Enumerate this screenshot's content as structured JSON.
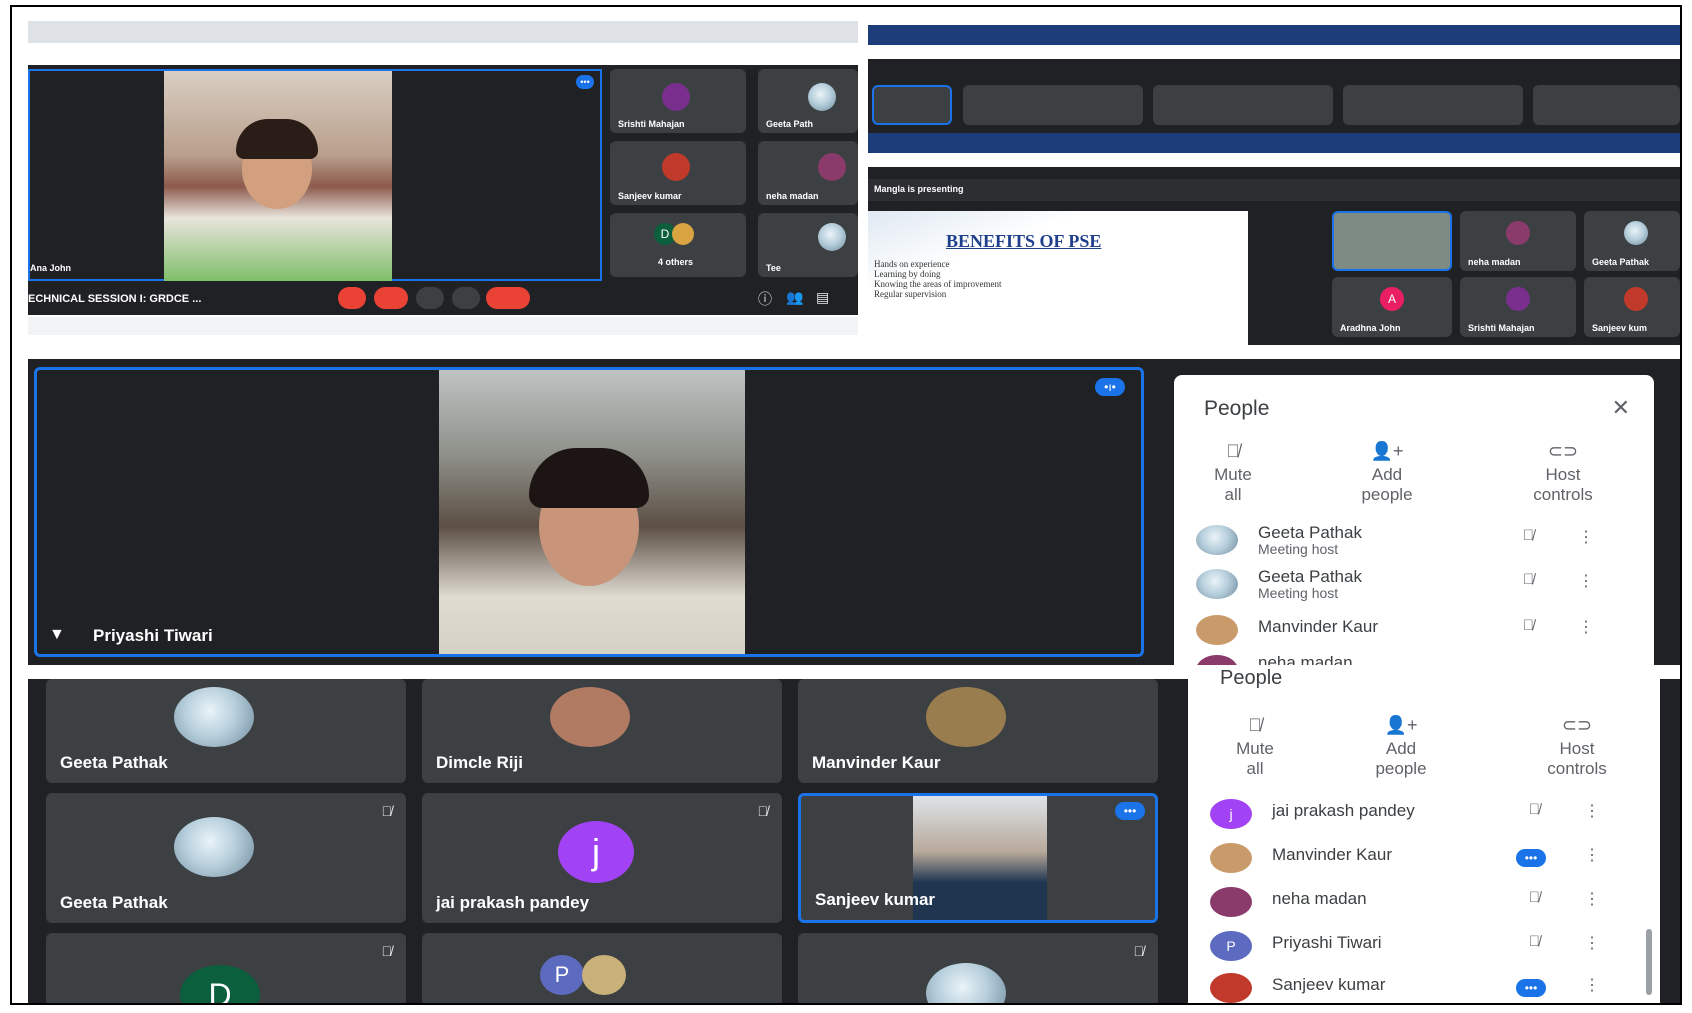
{
  "top_left": {
    "speaker_name": "Ana John",
    "session_title": "ECHNICAL SESSION I: GRDCE ...",
    "tiles": [
      {
        "name": "Srishti Mahajan"
      },
      {
        "name": "Geeta Path"
      },
      {
        "name": "Sanjeev kumar"
      },
      {
        "name": "neha madan"
      },
      {
        "name": "4 others",
        "initial": "D"
      },
      {
        "name": "Tee"
      }
    ]
  },
  "top_right": {
    "presenting_banner": "Mangla is presenting",
    "slide_title": "BENEFITS OF PSE",
    "slide_bullets": [
      "Hands on experience",
      "Learning by doing",
      "Knowing the areas of improvement",
      "Regular supervision"
    ],
    "tiles": [
      {
        "name": "neha madan"
      },
      {
        "name": "Geeta Pathak"
      },
      {
        "name": "Aradhna John",
        "initial": "A"
      },
      {
        "name": "Srishti Mahajan"
      },
      {
        "name": "Sanjeev kum"
      }
    ]
  },
  "middle": {
    "main_speaker": "Priyashi Tiwari",
    "people_panel": {
      "title": "People",
      "actions": [
        {
          "label": "Mute all",
          "line1": "Mute",
          "line2": "all",
          "icon": "mic-off-icon"
        },
        {
          "label": "Add people",
          "line1": "Add",
          "line2": "people",
          "icon": "person-add-icon"
        },
        {
          "label": "Host controls",
          "line1": "Host",
          "line2": "controls",
          "icon": "toggle-icon"
        }
      ],
      "participants": [
        {
          "name": "Geeta Pathak",
          "role": "Meeting host"
        },
        {
          "name": "Geeta Pathak",
          "role": "Meeting host"
        },
        {
          "name": "Manvinder Kaur",
          "role": ""
        },
        {
          "name": "neha madan",
          "role": ""
        }
      ]
    }
  },
  "bottom": {
    "tiles": [
      {
        "name": "Geeta Pathak"
      },
      {
        "name": "Dimcle Riji"
      },
      {
        "name": "Manvinder Kaur"
      },
      {
        "name": "Geeta Pathak"
      },
      {
        "name": "jai prakash pandey",
        "initial": "j"
      },
      {
        "name": "Sanjeev kumar"
      },
      {
        "name": "",
        "initial": "D"
      },
      {
        "name": "",
        "initial": "P"
      },
      {
        "name": ""
      }
    ],
    "people_panel": {
      "title": "People",
      "actions": [
        {
          "line1": "Mute",
          "line2": "all"
        },
        {
          "line1": "Add",
          "line2": "people"
        },
        {
          "line1": "Host",
          "line2": "controls"
        }
      ],
      "participants": [
        {
          "name": "jai prakash pandey",
          "initial": "j"
        },
        {
          "name": "Manvinder Kaur"
        },
        {
          "name": "neha madan"
        },
        {
          "name": "Priyashi Tiwari",
          "initial": "P"
        },
        {
          "name": "Sanjeev kumar"
        }
      ]
    }
  },
  "colors": {
    "meet_dark": "#202124",
    "tile_gray": "#3c4043",
    "meet_blue": "#1a73e8",
    "hangup_red": "#ea4335",
    "avatar_purple": "#a142f4",
    "avatar_green": "#0b5f3c"
  }
}
